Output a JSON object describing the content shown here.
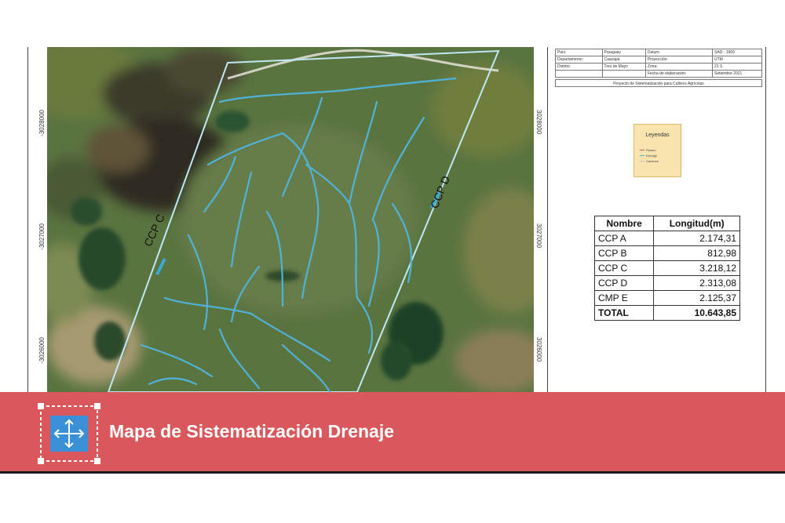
{
  "map": {
    "coords_left": [
      "-3028000",
      "-3027000",
      "-3026000"
    ],
    "coords_right": [
      "3028000",
      "3027000",
      "3026000"
    ],
    "labels": {
      "ccp_c": "CCP C",
      "ccp_d": "CCP D"
    },
    "colors": {
      "canal": "#4fb3d9",
      "boundary": "#bfe8f5",
      "road": "#e8e6e0"
    }
  },
  "info": {
    "rows": [
      [
        "País:",
        "Paraguay",
        "Datum:",
        "SAD - 1969"
      ],
      [
        "Departamento:",
        "Caazapá",
        "Proyección:",
        "UTM"
      ],
      [
        "Distrito:",
        "Tres de Mayo",
        "Zona:",
        "21 S"
      ],
      [
        "",
        "",
        "Fecha de elaboración:",
        "Setiembre 2021"
      ]
    ],
    "caption": "Proyecto de Sistematización para Cultivos Agrícolas"
  },
  "legend": {
    "title": "Leyendas",
    "items": [
      {
        "label": "Planeo",
        "color": "#d9585c"
      },
      {
        "label": "Drenaje",
        "color": "#4fb3d9"
      },
      {
        "label": "Caminos",
        "color": "#c9c3b5"
      }
    ]
  },
  "lengths": {
    "headers": [
      "Nombre",
      "Longitud(m)"
    ],
    "rows": [
      [
        "CCP A",
        "2.174,31"
      ],
      [
        "CCP B",
        "812,98"
      ],
      [
        "CCP C",
        "3.218,12"
      ],
      [
        "CCP D",
        "2.313,08"
      ],
      [
        "CMP E",
        "2.125,37"
      ]
    ],
    "total": [
      "TOTAL",
      "10.643,85"
    ]
  },
  "banner": {
    "title": "Mapa de Sistematización Drenaje",
    "color": "#d9585c",
    "icon": "resize-arrows-icon"
  }
}
